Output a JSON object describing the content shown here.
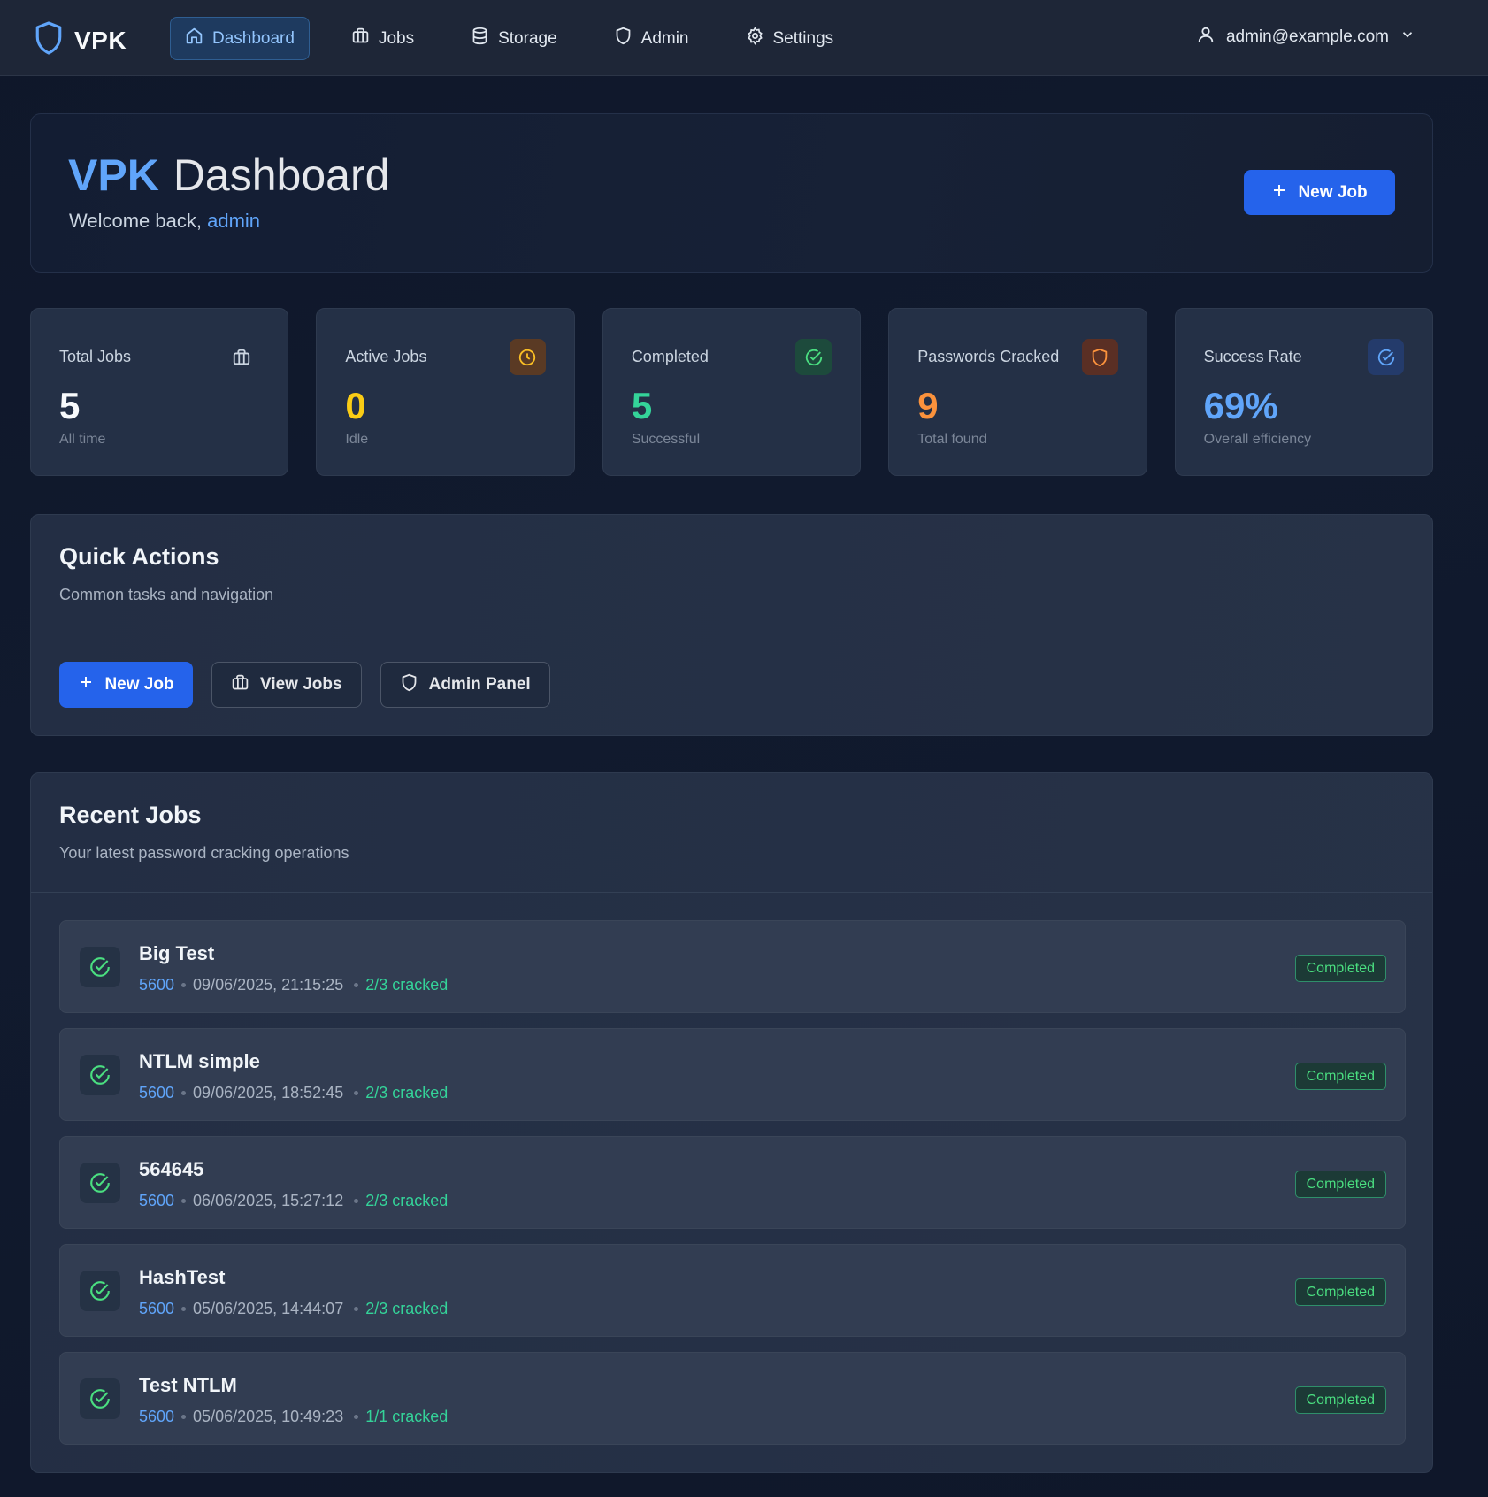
{
  "app": {
    "name": "VPK"
  },
  "nav": {
    "items": [
      {
        "label": "Dashboard",
        "icon": "home-icon",
        "active": true
      },
      {
        "label": "Jobs",
        "icon": "briefcase-icon",
        "active": false
      },
      {
        "label": "Storage",
        "icon": "database-icon",
        "active": false
      },
      {
        "label": "Admin",
        "icon": "shield-icon",
        "active": false
      },
      {
        "label": "Settings",
        "icon": "gear-icon",
        "active": false
      }
    ],
    "user": "admin@example.com"
  },
  "hero": {
    "title_accent": "VPK",
    "title_rest": "Dashboard",
    "welcome_prefix": "Welcome back,",
    "username": "admin",
    "new_job_label": "New Job"
  },
  "stats": [
    {
      "label": "Total Jobs",
      "value": "5",
      "sub": "All time",
      "icon": "briefcase-icon",
      "color": "#f8fafc",
      "icon_bg": "transparent",
      "icon_color": "#cbd5e1"
    },
    {
      "label": "Active Jobs",
      "value": "0",
      "sub": "Idle",
      "icon": "clock-icon",
      "color": "#facc15",
      "icon_bg": "#5a3a24",
      "icon_color": "#fbbf24"
    },
    {
      "label": "Completed",
      "value": "5",
      "sub": "Successful",
      "icon": "check-circle-icon",
      "color": "#34d399",
      "icon_bg": "#1d4a3c",
      "icon_color": "#4ade80"
    },
    {
      "label": "Passwords Cracked",
      "value": "9",
      "sub": "Total found",
      "icon": "shield-icon",
      "color": "#fb923c",
      "icon_bg": "#5a2f24",
      "icon_color": "#fb923c"
    },
    {
      "label": "Success Rate",
      "value": "69%",
      "sub": "Overall efficiency",
      "icon": "check-circle-icon",
      "color": "#60a5fa",
      "icon_bg": "#243b6b",
      "icon_color": "#60a5fa"
    }
  ],
  "quick_actions": {
    "title": "Quick Actions",
    "subtitle": "Common tasks and navigation",
    "new_job": "New Job",
    "view_jobs": "View Jobs",
    "admin_panel": "Admin Panel"
  },
  "recent_jobs": {
    "title": "Recent Jobs",
    "subtitle": "Your latest password cracking operations",
    "jobs": [
      {
        "name": "Big Test",
        "mode": "5600",
        "date": "09/06/2025, 21:15:25",
        "cracked": "2/3 cracked",
        "status": "Completed"
      },
      {
        "name": "NTLM simple",
        "mode": "5600",
        "date": "09/06/2025, 18:52:45",
        "cracked": "2/3 cracked",
        "status": "Completed"
      },
      {
        "name": "564645",
        "mode": "5600",
        "date": "06/06/2025, 15:27:12",
        "cracked": "2/3 cracked",
        "status": "Completed"
      },
      {
        "name": "HashTest",
        "mode": "5600",
        "date": "05/06/2025, 14:44:07",
        "cracked": "2/3 cracked",
        "status": "Completed"
      },
      {
        "name": "Test NTLM",
        "mode": "5600",
        "date": "05/06/2025, 10:49:23",
        "cracked": "1/1 cracked",
        "status": "Completed"
      }
    ]
  }
}
